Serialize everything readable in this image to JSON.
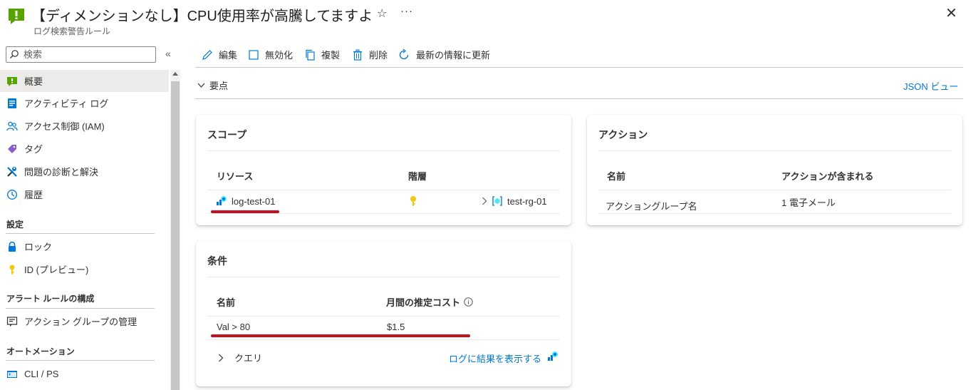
{
  "header": {
    "title": "【ディメンションなし】CPU使用率が高騰してますよ",
    "subtitle": "ログ検索警告ルール",
    "star_icon": "star-icon",
    "more_icon": "more-icon",
    "close_icon": "close-icon",
    "brand_color": "#57a300"
  },
  "sidebar": {
    "search_placeholder": "検索",
    "collapse_icon": "«",
    "items": [
      {
        "label": "概要",
        "icon": "alert-rule-icon",
        "active": true
      },
      {
        "label": "アクティビティ ログ",
        "icon": "activity-log-icon"
      },
      {
        "label": "アクセス制御 (IAM)",
        "icon": "people-icon"
      },
      {
        "label": "タグ",
        "icon": "tag-icon"
      },
      {
        "label": "問題の診断と解決",
        "icon": "wrench-icon"
      },
      {
        "label": "履歴",
        "icon": "clock-icon"
      }
    ],
    "sections": [
      {
        "title": "設定",
        "items": [
          {
            "label": "ロック",
            "icon": "lock-icon"
          },
          {
            "label": "ID (プレビュー)",
            "icon": "key-icon"
          }
        ]
      },
      {
        "title": "アラート ルールの構成",
        "items": [
          {
            "label": "アクション グループの管理",
            "icon": "action-group-icon"
          }
        ]
      },
      {
        "title": "オートメーション",
        "items": [
          {
            "label": "CLI / PS",
            "icon": "cli-icon"
          }
        ]
      }
    ]
  },
  "toolbar": {
    "edit": "編集",
    "disable": "無効化",
    "duplicate": "複製",
    "delete": "削除",
    "refresh": "最新の情報に更新"
  },
  "essentials": {
    "label": "要点",
    "json_view": "JSON ビュー"
  },
  "scope_card": {
    "title": "スコープ",
    "col_resource": "リソース",
    "col_hierarchy": "階層",
    "resource": "log-test-01",
    "resource_group": "test-rg-01"
  },
  "action_card": {
    "title": "アクション",
    "col_name": "名前",
    "col_included": "アクションが含まれる",
    "name": "アクショングループ名",
    "included": "1 電子メール"
  },
  "condition_card": {
    "title": "条件",
    "col_name": "名前",
    "col_cost": "月間の推定コスト",
    "name": "Val > 80",
    "cost": "$1.5",
    "query_label": "クエリ",
    "view_logs": "ログに結果を表示する"
  },
  "colors": {
    "link": "#0078d4",
    "highlight_underline": "#c50f1f"
  }
}
